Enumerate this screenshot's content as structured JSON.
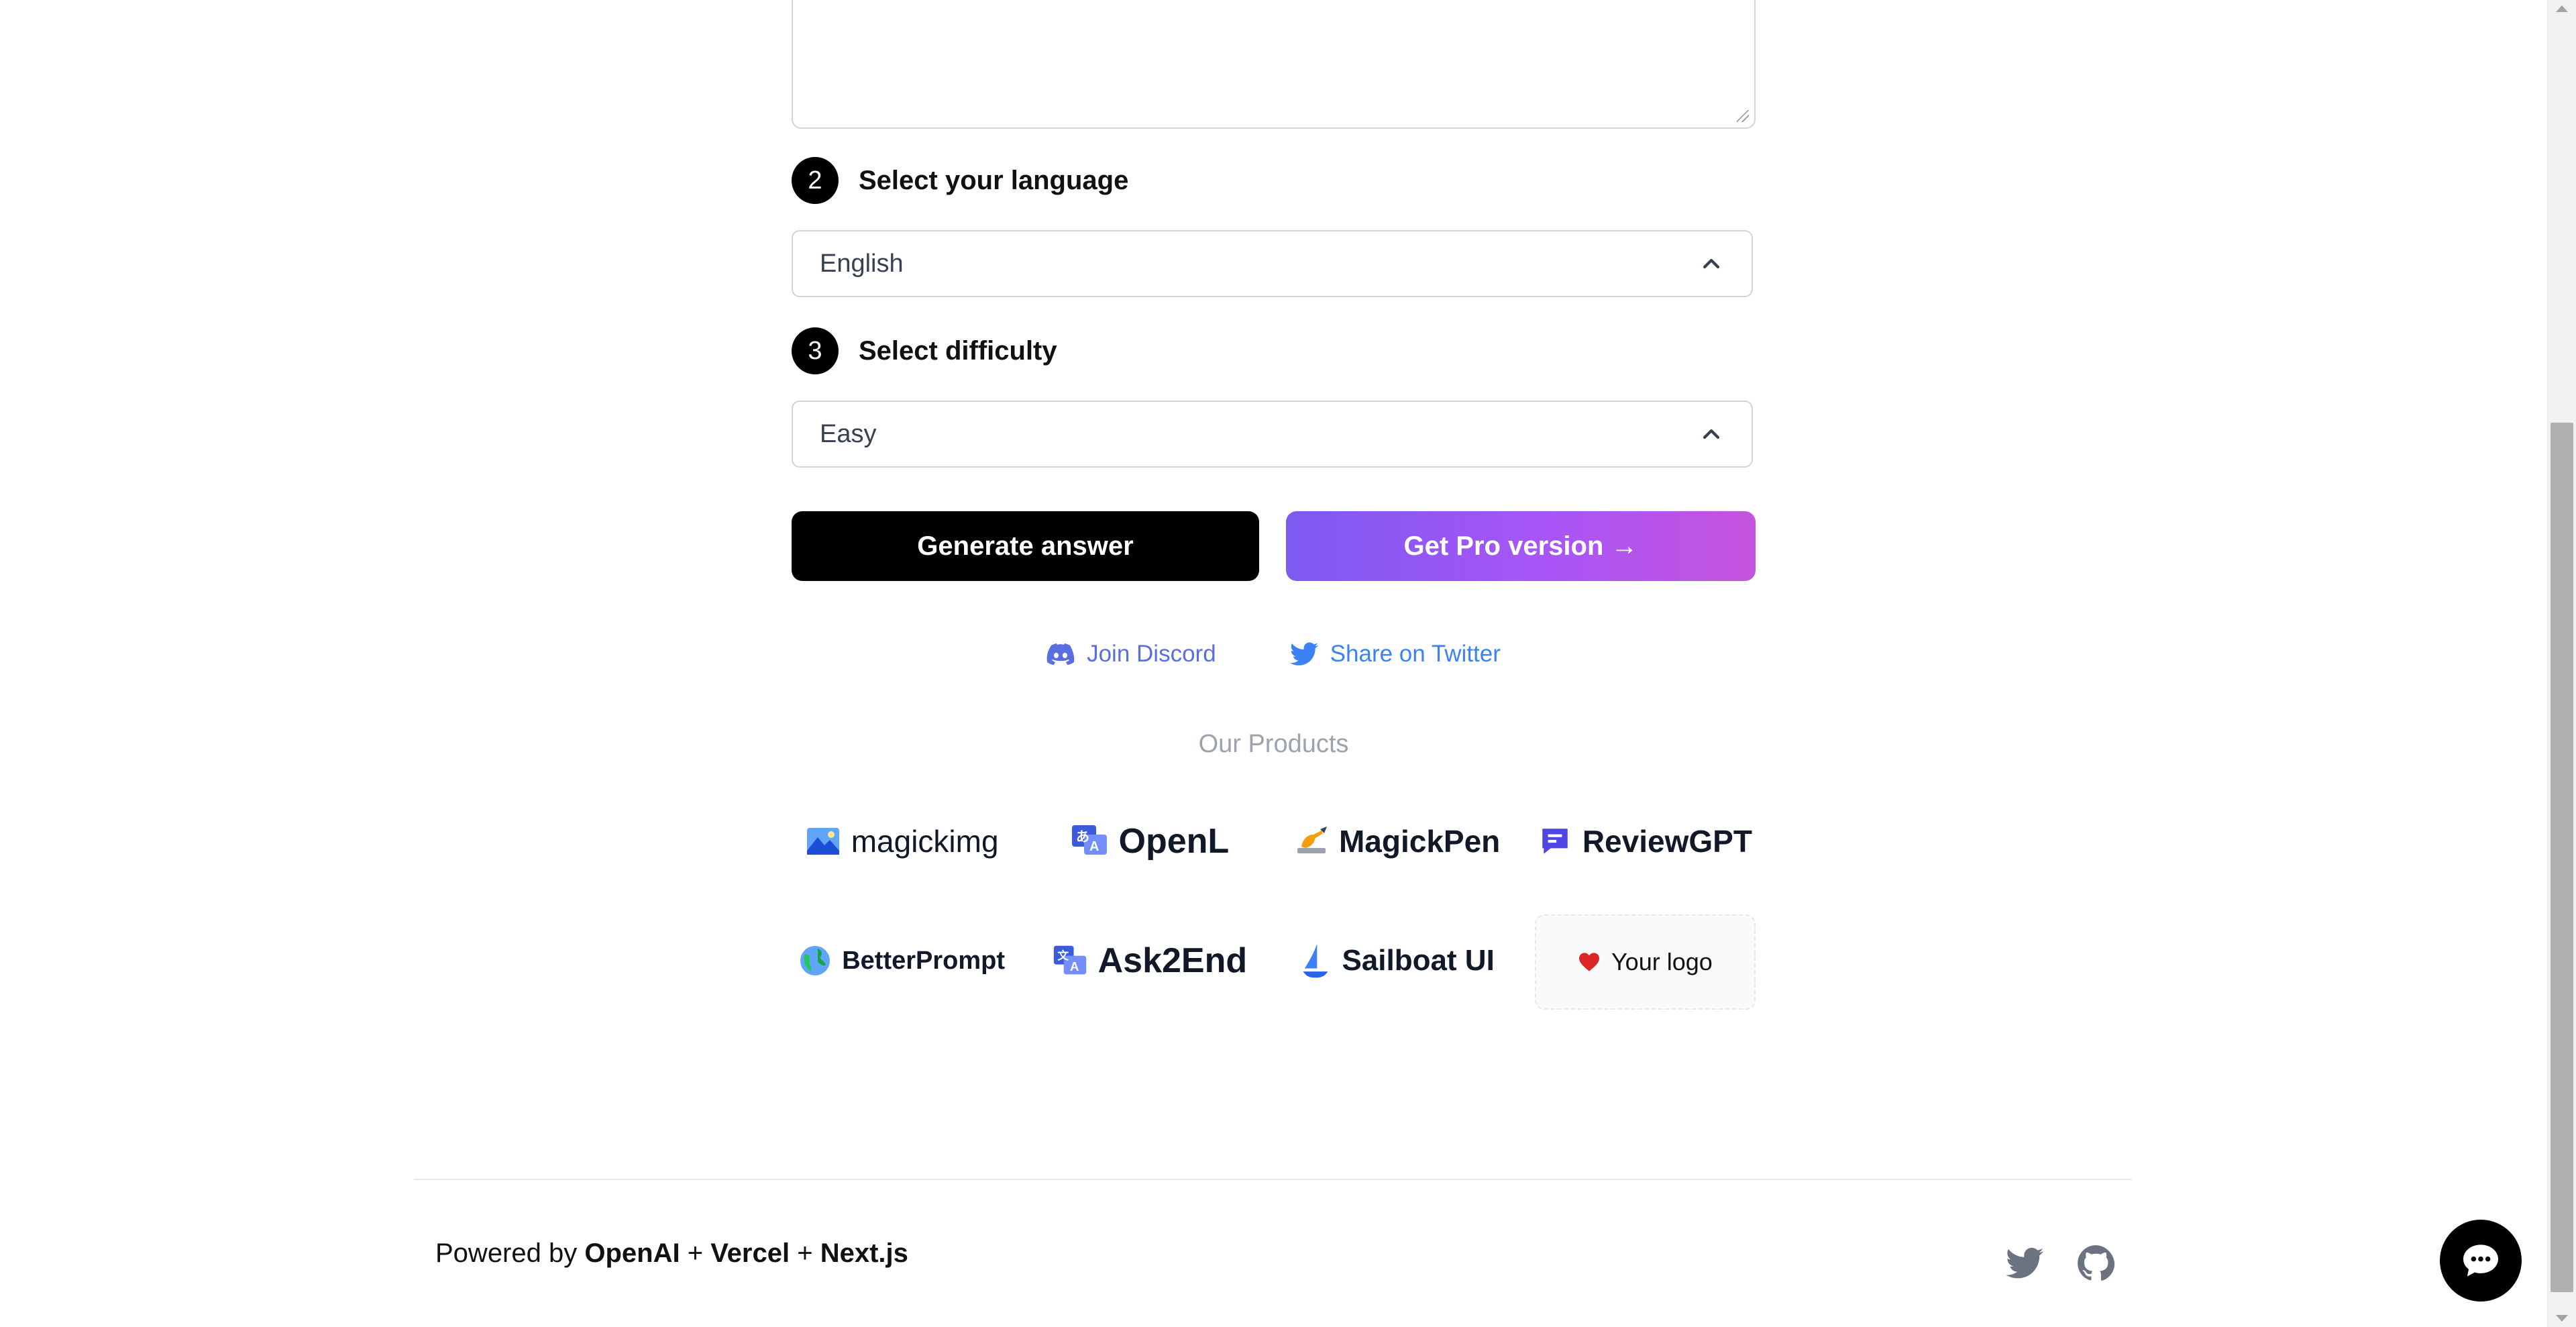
{
  "form": {
    "step2": {
      "number": "2",
      "label": "Select your language"
    },
    "language_value": "English",
    "step3": {
      "number": "3",
      "label": "Select difficulty"
    },
    "difficulty_value": "Easy",
    "generate_label": "Generate answer",
    "pro_label": "Get Pro version →"
  },
  "social": {
    "discord_label": "Join Discord",
    "twitter_label": "Share on Twitter"
  },
  "products": {
    "title": "Our Products",
    "items": [
      {
        "name": "magickimg",
        "icon": "mountain-image-icon"
      },
      {
        "name": "OpenL",
        "icon": "translate-icon"
      },
      {
        "name": "MagickPen",
        "icon": "writing-hand-icon"
      },
      {
        "name": "ReviewGPT",
        "icon": "chat-message-icon"
      },
      {
        "name": "BetterPrompt",
        "icon": "globe-icon"
      },
      {
        "name": "Ask2End",
        "icon": "translate-icon"
      },
      {
        "name": "Sailboat UI",
        "icon": "sailboat-icon"
      },
      {
        "name": "Your logo",
        "icon": "heart-icon"
      }
    ]
  },
  "footer": {
    "powered_prefix": "Powered by",
    "openai": "OpenAI",
    "plus1": "+",
    "vercel": "Vercel",
    "plus2": "+",
    "nextjs": "Next.js"
  },
  "colors": {
    "primary": "#000000",
    "pro_gradient_start": "#7d5af0",
    "pro_gradient_end": "#c554de",
    "discord": "#5b6ee1",
    "twitter": "#3b82f6"
  }
}
